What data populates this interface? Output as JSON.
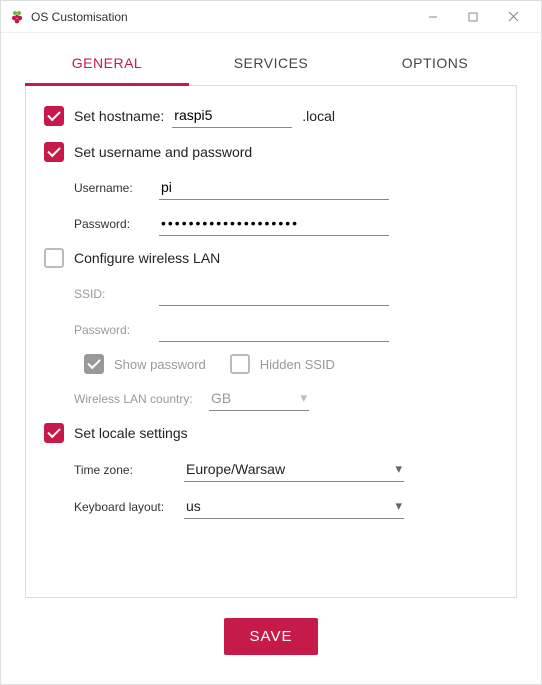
{
  "window": {
    "title": "OS Customisation"
  },
  "tabs": {
    "general": "GENERAL",
    "services": "SERVICES",
    "options": "OPTIONS"
  },
  "hostname": {
    "label": "Set hostname:",
    "value": "raspi5",
    "suffix": ".local",
    "checked": true
  },
  "credentials": {
    "label": "Set username and password",
    "checked": true,
    "username_label": "Username:",
    "username_value": "pi",
    "password_label": "Password:",
    "password_value": "••••••••••••••••••••"
  },
  "wifi": {
    "label": "Configure wireless LAN",
    "checked": false,
    "ssid_label": "SSID:",
    "ssid_value": "",
    "password_label": "Password:",
    "password_value": "",
    "show_password_label": "Show password",
    "show_password_checked": true,
    "hidden_ssid_label": "Hidden SSID",
    "hidden_ssid_checked": false,
    "country_label": "Wireless LAN country:",
    "country_value": "GB"
  },
  "locale": {
    "label": "Set locale settings",
    "checked": true,
    "timezone_label": "Time zone:",
    "timezone_value": "Europe/Warsaw",
    "keyboard_label": "Keyboard layout:",
    "keyboard_value": "us"
  },
  "footer": {
    "save_label": "SAVE"
  }
}
